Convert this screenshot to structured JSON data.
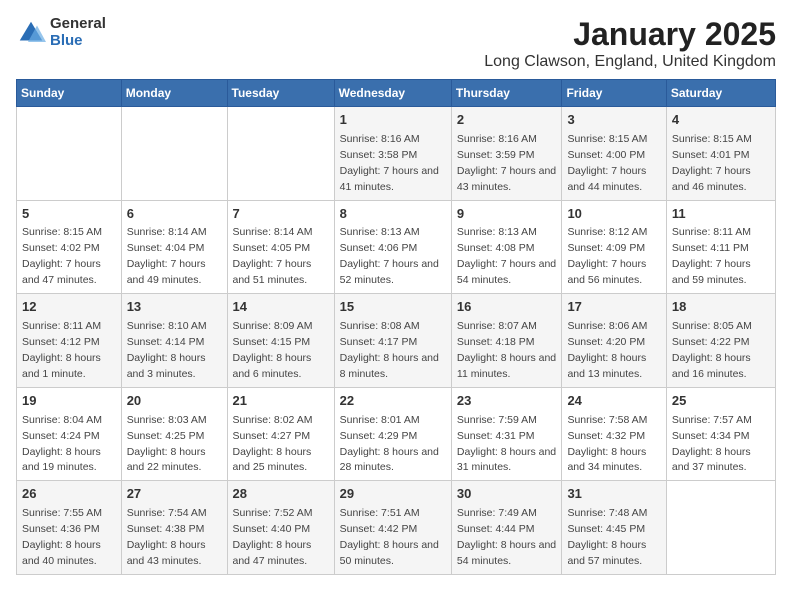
{
  "logo": {
    "general": "General",
    "blue": "Blue"
  },
  "title": "January 2025",
  "subtitle": "Long Clawson, England, United Kingdom",
  "days_of_week": [
    "Sunday",
    "Monday",
    "Tuesday",
    "Wednesday",
    "Thursday",
    "Friday",
    "Saturday"
  ],
  "weeks": [
    [
      {
        "day": "",
        "sunrise": "",
        "sunset": "",
        "daylight": ""
      },
      {
        "day": "",
        "sunrise": "",
        "sunset": "",
        "daylight": ""
      },
      {
        "day": "",
        "sunrise": "",
        "sunset": "",
        "daylight": ""
      },
      {
        "day": "1",
        "sunrise": "Sunrise: 8:16 AM",
        "sunset": "Sunset: 3:58 PM",
        "daylight": "Daylight: 7 hours and 41 minutes."
      },
      {
        "day": "2",
        "sunrise": "Sunrise: 8:16 AM",
        "sunset": "Sunset: 3:59 PM",
        "daylight": "Daylight: 7 hours and 43 minutes."
      },
      {
        "day": "3",
        "sunrise": "Sunrise: 8:15 AM",
        "sunset": "Sunset: 4:00 PM",
        "daylight": "Daylight: 7 hours and 44 minutes."
      },
      {
        "day": "4",
        "sunrise": "Sunrise: 8:15 AM",
        "sunset": "Sunset: 4:01 PM",
        "daylight": "Daylight: 7 hours and 46 minutes."
      }
    ],
    [
      {
        "day": "5",
        "sunrise": "Sunrise: 8:15 AM",
        "sunset": "Sunset: 4:02 PM",
        "daylight": "Daylight: 7 hours and 47 minutes."
      },
      {
        "day": "6",
        "sunrise": "Sunrise: 8:14 AM",
        "sunset": "Sunset: 4:04 PM",
        "daylight": "Daylight: 7 hours and 49 minutes."
      },
      {
        "day": "7",
        "sunrise": "Sunrise: 8:14 AM",
        "sunset": "Sunset: 4:05 PM",
        "daylight": "Daylight: 7 hours and 51 minutes."
      },
      {
        "day": "8",
        "sunrise": "Sunrise: 8:13 AM",
        "sunset": "Sunset: 4:06 PM",
        "daylight": "Daylight: 7 hours and 52 minutes."
      },
      {
        "day": "9",
        "sunrise": "Sunrise: 8:13 AM",
        "sunset": "Sunset: 4:08 PM",
        "daylight": "Daylight: 7 hours and 54 minutes."
      },
      {
        "day": "10",
        "sunrise": "Sunrise: 8:12 AM",
        "sunset": "Sunset: 4:09 PM",
        "daylight": "Daylight: 7 hours and 56 minutes."
      },
      {
        "day": "11",
        "sunrise": "Sunrise: 8:11 AM",
        "sunset": "Sunset: 4:11 PM",
        "daylight": "Daylight: 7 hours and 59 minutes."
      }
    ],
    [
      {
        "day": "12",
        "sunrise": "Sunrise: 8:11 AM",
        "sunset": "Sunset: 4:12 PM",
        "daylight": "Daylight: 8 hours and 1 minute."
      },
      {
        "day": "13",
        "sunrise": "Sunrise: 8:10 AM",
        "sunset": "Sunset: 4:14 PM",
        "daylight": "Daylight: 8 hours and 3 minutes."
      },
      {
        "day": "14",
        "sunrise": "Sunrise: 8:09 AM",
        "sunset": "Sunset: 4:15 PM",
        "daylight": "Daylight: 8 hours and 6 minutes."
      },
      {
        "day": "15",
        "sunrise": "Sunrise: 8:08 AM",
        "sunset": "Sunset: 4:17 PM",
        "daylight": "Daylight: 8 hours and 8 minutes."
      },
      {
        "day": "16",
        "sunrise": "Sunrise: 8:07 AM",
        "sunset": "Sunset: 4:18 PM",
        "daylight": "Daylight: 8 hours and 11 minutes."
      },
      {
        "day": "17",
        "sunrise": "Sunrise: 8:06 AM",
        "sunset": "Sunset: 4:20 PM",
        "daylight": "Daylight: 8 hours and 13 minutes."
      },
      {
        "day": "18",
        "sunrise": "Sunrise: 8:05 AM",
        "sunset": "Sunset: 4:22 PM",
        "daylight": "Daylight: 8 hours and 16 minutes."
      }
    ],
    [
      {
        "day": "19",
        "sunrise": "Sunrise: 8:04 AM",
        "sunset": "Sunset: 4:24 PM",
        "daylight": "Daylight: 8 hours and 19 minutes."
      },
      {
        "day": "20",
        "sunrise": "Sunrise: 8:03 AM",
        "sunset": "Sunset: 4:25 PM",
        "daylight": "Daylight: 8 hours and 22 minutes."
      },
      {
        "day": "21",
        "sunrise": "Sunrise: 8:02 AM",
        "sunset": "Sunset: 4:27 PM",
        "daylight": "Daylight: 8 hours and 25 minutes."
      },
      {
        "day": "22",
        "sunrise": "Sunrise: 8:01 AM",
        "sunset": "Sunset: 4:29 PM",
        "daylight": "Daylight: 8 hours and 28 minutes."
      },
      {
        "day": "23",
        "sunrise": "Sunrise: 7:59 AM",
        "sunset": "Sunset: 4:31 PM",
        "daylight": "Daylight: 8 hours and 31 minutes."
      },
      {
        "day": "24",
        "sunrise": "Sunrise: 7:58 AM",
        "sunset": "Sunset: 4:32 PM",
        "daylight": "Daylight: 8 hours and 34 minutes."
      },
      {
        "day": "25",
        "sunrise": "Sunrise: 7:57 AM",
        "sunset": "Sunset: 4:34 PM",
        "daylight": "Daylight: 8 hours and 37 minutes."
      }
    ],
    [
      {
        "day": "26",
        "sunrise": "Sunrise: 7:55 AM",
        "sunset": "Sunset: 4:36 PM",
        "daylight": "Daylight: 8 hours and 40 minutes."
      },
      {
        "day": "27",
        "sunrise": "Sunrise: 7:54 AM",
        "sunset": "Sunset: 4:38 PM",
        "daylight": "Daylight: 8 hours and 43 minutes."
      },
      {
        "day": "28",
        "sunrise": "Sunrise: 7:52 AM",
        "sunset": "Sunset: 4:40 PM",
        "daylight": "Daylight: 8 hours and 47 minutes."
      },
      {
        "day": "29",
        "sunrise": "Sunrise: 7:51 AM",
        "sunset": "Sunset: 4:42 PM",
        "daylight": "Daylight: 8 hours and 50 minutes."
      },
      {
        "day": "30",
        "sunrise": "Sunrise: 7:49 AM",
        "sunset": "Sunset: 4:44 PM",
        "daylight": "Daylight: 8 hours and 54 minutes."
      },
      {
        "day": "31",
        "sunrise": "Sunrise: 7:48 AM",
        "sunset": "Sunset: 4:45 PM",
        "daylight": "Daylight: 8 hours and 57 minutes."
      },
      {
        "day": "",
        "sunrise": "",
        "sunset": "",
        "daylight": ""
      }
    ]
  ]
}
